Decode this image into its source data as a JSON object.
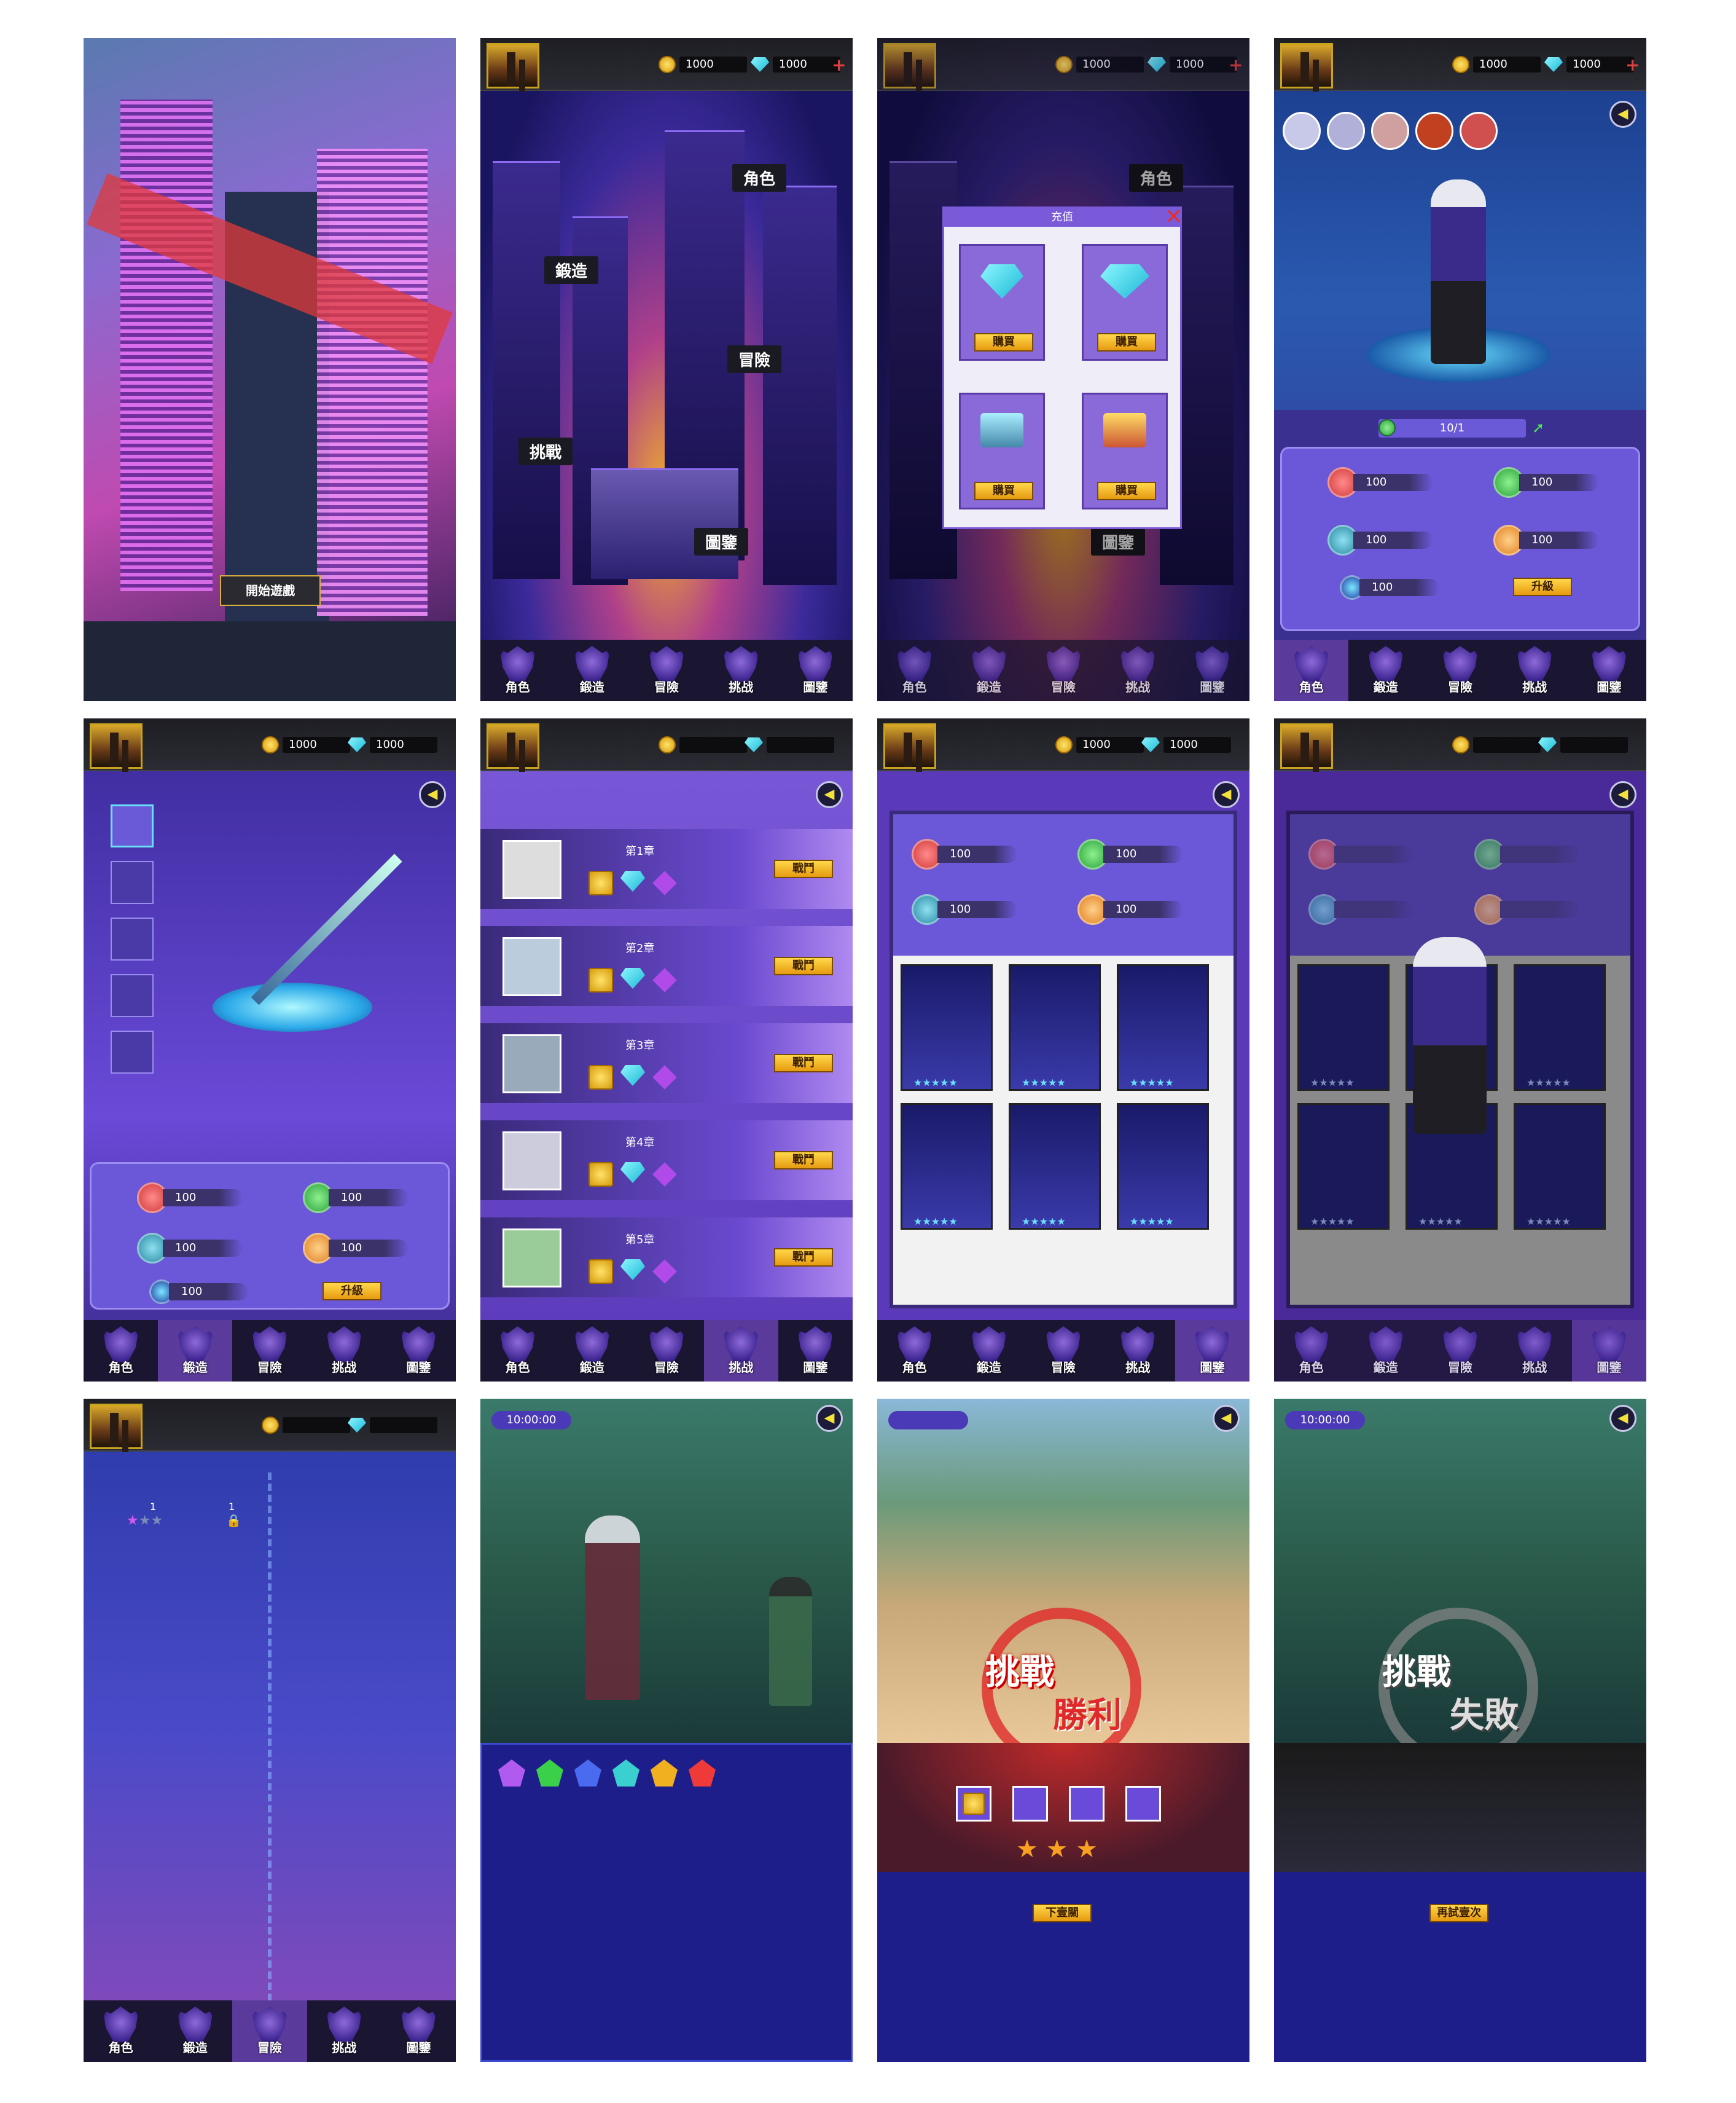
{
  "nav": {
    "items": [
      "角色",
      "鍛造",
      "冒險",
      "挑战",
      "圖鑒"
    ]
  },
  "currency": {
    "coins": "1000",
    "gems": "1000"
  },
  "start": {
    "button": "開始遊戲"
  },
  "hub": {
    "labels": {
      "role": "角色",
      "forge": "鍛造",
      "adventure": "冒險",
      "challenge": "挑戰",
      "atlas": "圖鑒"
    }
  },
  "recharge": {
    "title": "充值",
    "buy": "購買"
  },
  "stats": {
    "v": "100",
    "level": "10/1",
    "upgrade": "升級"
  },
  "chapters": [
    {
      "title": "第1章",
      "fight": "戰鬥"
    },
    {
      "title": "第2章",
      "fight": "戰鬥"
    },
    {
      "title": "第3章",
      "fight": "戰鬥"
    },
    {
      "title": "第4章",
      "fight": "戰鬥"
    },
    {
      "title": "第5章",
      "fight": "戰鬥"
    }
  ],
  "map": {
    "n1": "1",
    "n2": "1"
  },
  "battle": {
    "timer": "10:00:00",
    "win_top": "挑戰",
    "win_bottom": "勝利",
    "lose_top": "挑戰",
    "lose_bottom": "失敗",
    "next": "下壹關",
    "retry": "再試壹次"
  },
  "colors": {
    "accent": "#6b58d8",
    "gold": "#e69a10",
    "nav_bg": "#1a1530"
  }
}
